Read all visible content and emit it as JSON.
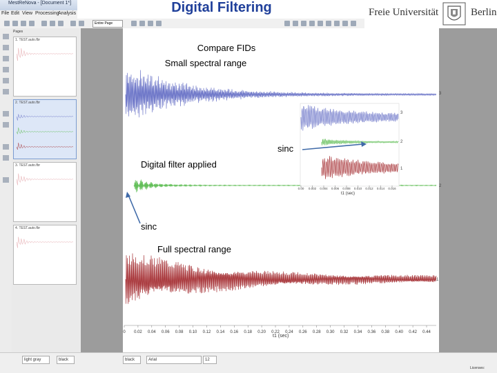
{
  "app": {
    "title": "MestReNova - [Document 1*]",
    "menus": [
      "File",
      "Edit",
      "View",
      "Processing",
      "Analysis"
    ],
    "zoom": "Entire Page"
  },
  "slide": {
    "title": "Digital Filtering",
    "logo_left": "Freie Universität",
    "logo_right": "Berlin"
  },
  "pages_panel": {
    "label": "Pages",
    "pages": [
      {
        "label": "1. TEST.auto.fbr"
      },
      {
        "label": "2. TEST.auto.fbr"
      },
      {
        "label": "3. TEST.auto.fbr"
      },
      {
        "label": "4. TEST.auto.fbr"
      }
    ]
  },
  "figure": {
    "caption_compare": "Compare FIDs",
    "caption_small": "Small spectral range",
    "caption_sinc_top": "sinc",
    "caption_digital": "Digital filter applied",
    "caption_sinc_left": "sinc",
    "caption_full": "Full spectral range",
    "time_axis_label": "t1 (sec)",
    "inset_axis_label": "t1 (sec)",
    "time_ticks": [
      "0",
      "0.02",
      "0.04",
      "0.06",
      "0.08",
      "0.10",
      "0.12",
      "0.14",
      "0.16",
      "0.18",
      "0.20",
      "0.22",
      "0.24",
      "0.26",
      "0.28",
      "0.30",
      "0.32",
      "0.34",
      "0.36",
      "0.38",
      "0.40",
      "0.42",
      "0.44"
    ],
    "inset_ticks": [
      "0.00",
      "0.002",
      "0.004",
      "0.006",
      "0.008",
      "0.010",
      "0.012",
      "0.014",
      "0.016"
    ],
    "trace_labels": [
      "3",
      "2",
      "1"
    ],
    "colors": {
      "small_range": "#6f78c9",
      "digital_filter": "#63bf59",
      "full_range": "#a8363a",
      "arrow": "#3f6aa8"
    }
  },
  "statusbar": {
    "color_field": "light gray",
    "color_field2": "black",
    "line_color": "black",
    "font": "Arial",
    "font_size": "12",
    "licenses": "Licenses:"
  }
}
